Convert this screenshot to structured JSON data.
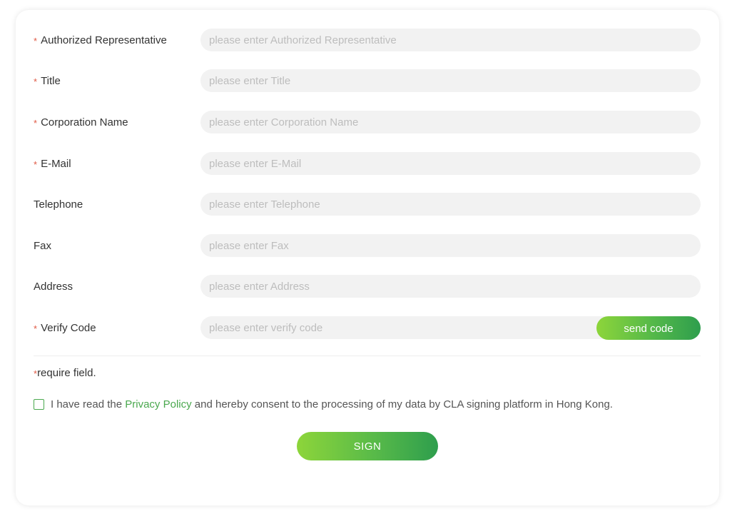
{
  "form": {
    "fields": [
      {
        "label": "Authorized Representative",
        "required": true,
        "placeholder": "please enter Authorized Representative",
        "value": ""
      },
      {
        "label": "Title",
        "required": true,
        "placeholder": "please enter Title",
        "value": ""
      },
      {
        "label": "Corporation Name",
        "required": true,
        "placeholder": "please enter Corporation Name",
        "value": ""
      },
      {
        "label": "E-Mail",
        "required": true,
        "placeholder": "please enter E-Mail",
        "value": ""
      },
      {
        "label": "Telephone",
        "required": false,
        "placeholder": "please enter Telephone",
        "value": ""
      },
      {
        "label": "Fax",
        "required": false,
        "placeholder": "please enter Fax",
        "value": ""
      },
      {
        "label": "Address",
        "required": false,
        "placeholder": "please enter Address",
        "value": ""
      },
      {
        "label": "Verify Code",
        "required": true,
        "placeholder": "please enter verify code",
        "value": ""
      }
    ],
    "required_marker": "*",
    "send_code_label": "send code",
    "require_note": "require field."
  },
  "consent": {
    "checked": false,
    "text_before": "I have read the ",
    "link_text": "Privacy Policy",
    "text_after": " and hereby consent to the processing of my data by CLA signing platform in Hong Kong."
  },
  "sign_label": "SIGN",
  "colors": {
    "required_star": "#e05a45",
    "accent_green": "#4aa84e",
    "gradient_start": "#8dd53a",
    "gradient_end": "#2e9e4d",
    "input_bg": "#f2f2f2"
  }
}
